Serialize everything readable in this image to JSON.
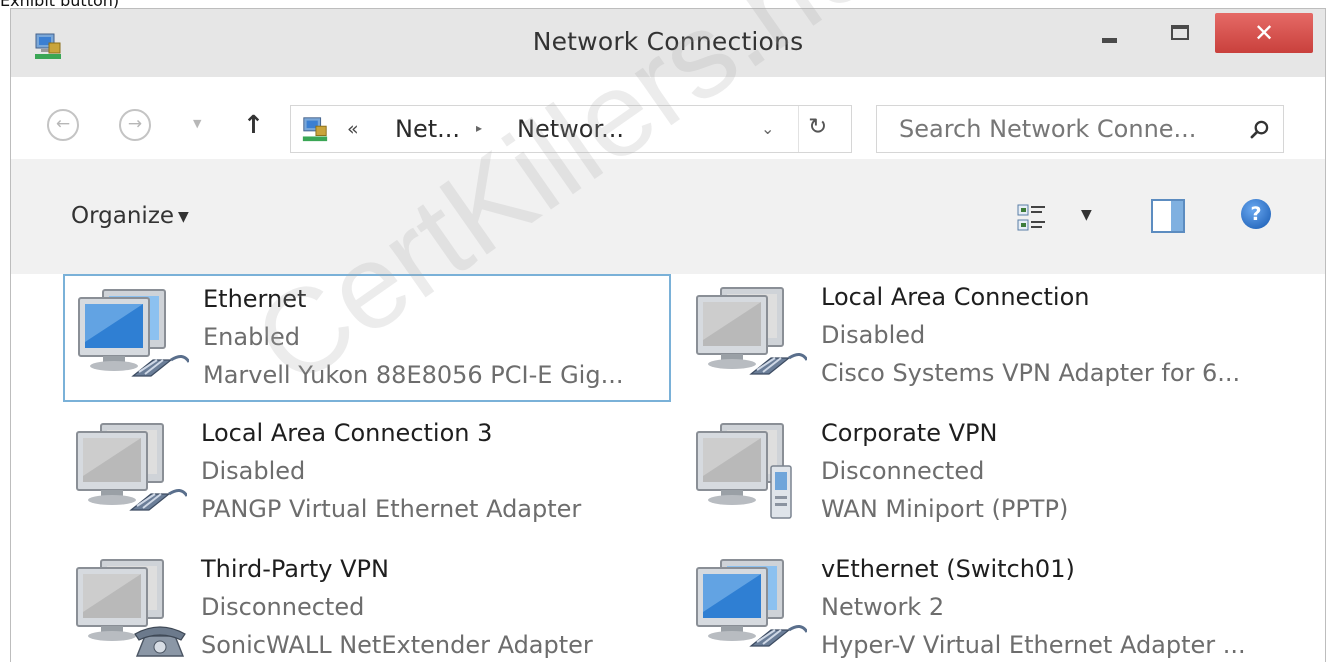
{
  "caption": "Exhibit button)",
  "window": {
    "title": "Network Connections",
    "minimize_glyph": "–",
    "close_glyph": "✕"
  },
  "nav": {
    "back_glyph": "←",
    "forward_glyph": "→",
    "recent_glyph": "▼",
    "up_glyph": "↑",
    "breadcrumb_overflow": "«",
    "breadcrumbs": [
      "Net...",
      "Networ..."
    ],
    "breadcrumb_separator": "▸",
    "dropdown_glyph": "⌄",
    "refresh_glyph": "↻",
    "search_placeholder": "Search Network Conne..."
  },
  "commandbar": {
    "organize_label": "Organize",
    "organize_caret": "▼",
    "view_caret": "▼",
    "help_glyph": "?"
  },
  "connections": [
    {
      "name": "Ethernet",
      "status": "Enabled",
      "device": "Marvell Yukon 88E8056 PCI-E Gig...",
      "icon": "ethernet-adapter-icon",
      "selected": true
    },
    {
      "name": "Local Area Connection",
      "status": "Disabled",
      "device": "Cisco Systems VPN Adapter for 6...",
      "icon": "ethernet-adapter-icon-disabled",
      "selected": false
    },
    {
      "name": "Local Area Connection 3",
      "status": "Disabled",
      "device": "PANGP Virtual Ethernet Adapter",
      "icon": "ethernet-adapter-icon-disabled",
      "selected": false
    },
    {
      "name": "Corporate VPN",
      "status": "Disconnected",
      "device": "WAN Miniport (PPTP)",
      "icon": "vpn-server-icon",
      "selected": false
    },
    {
      "name": "Third-Party VPN",
      "status": "Disconnected",
      "device": "SonicWALL NetExtender Adapter",
      "icon": "dialup-phone-icon",
      "selected": false
    },
    {
      "name": "vEthernet (Switch01)",
      "status": "Network 2",
      "device": "Hyper-V Virtual Ethernet Adapter ...",
      "icon": "ethernet-adapter-icon",
      "selected": false
    }
  ],
  "watermark": "CertKillers.net",
  "colors": {
    "selection_border": "#7ab1d8",
    "close_button": "#d9534f",
    "monitor_screen_active": "#2f7fd3",
    "monitor_screen_inactive": "#b9b9b9"
  }
}
